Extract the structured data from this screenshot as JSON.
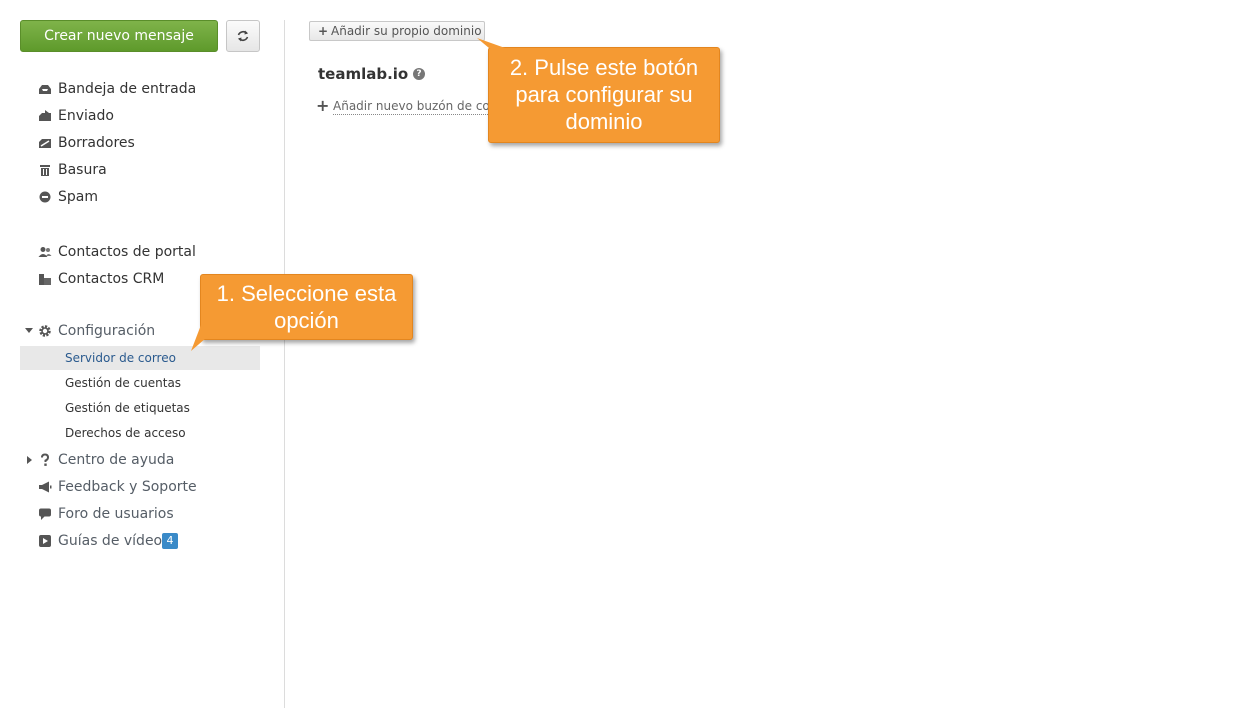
{
  "sidebar": {
    "compose_label": "Crear nuevo mensaje",
    "folders": [
      {
        "label": "Bandeja de entrada",
        "icon": "inbox-icon"
      },
      {
        "label": "Enviado",
        "icon": "sent-icon"
      },
      {
        "label": "Borradores",
        "icon": "drafts-icon"
      },
      {
        "label": "Basura",
        "icon": "trash-icon"
      },
      {
        "label": "Spam",
        "icon": "spam-icon"
      }
    ],
    "contacts": [
      {
        "label": "Contactos de portal",
        "icon": "people-icon"
      },
      {
        "label": "Contactos CRM",
        "icon": "crm-icon"
      }
    ],
    "settings": {
      "label": "Configuración",
      "icon": "gear-icon",
      "subitems": [
        {
          "label": "Servidor de correo",
          "selected": true
        },
        {
          "label": "Gestión de cuentas"
        },
        {
          "label": "Gestión de etiquetas"
        },
        {
          "label": "Derechos de acceso"
        }
      ]
    },
    "help": [
      {
        "label": "Centro de ayuda",
        "icon": "question-icon"
      },
      {
        "label": "Feedback y Soporte",
        "icon": "megaphone-icon"
      },
      {
        "label": "Foro de usuarios",
        "icon": "speech-bubble-icon"
      },
      {
        "label": "Guías de vídeo",
        "icon": "play-icon",
        "badge": "4"
      }
    ]
  },
  "main": {
    "add_domain_label": "Añadir su propio dominio",
    "domain_name": "teamlab.io",
    "add_mailbox_label": "Añadir nuevo buzón de correo"
  },
  "callouts": {
    "step1": "1. Seleccione esta opción",
    "step2": "2. Pulse este botón para configurar su dominio"
  },
  "colors": {
    "compose_green": "#6aa533",
    "callout_orange": "#f59a33",
    "selected_bg": "#e8e8e8",
    "badge_blue": "#3a8ac8",
    "active_link": "#2a5a8e"
  }
}
